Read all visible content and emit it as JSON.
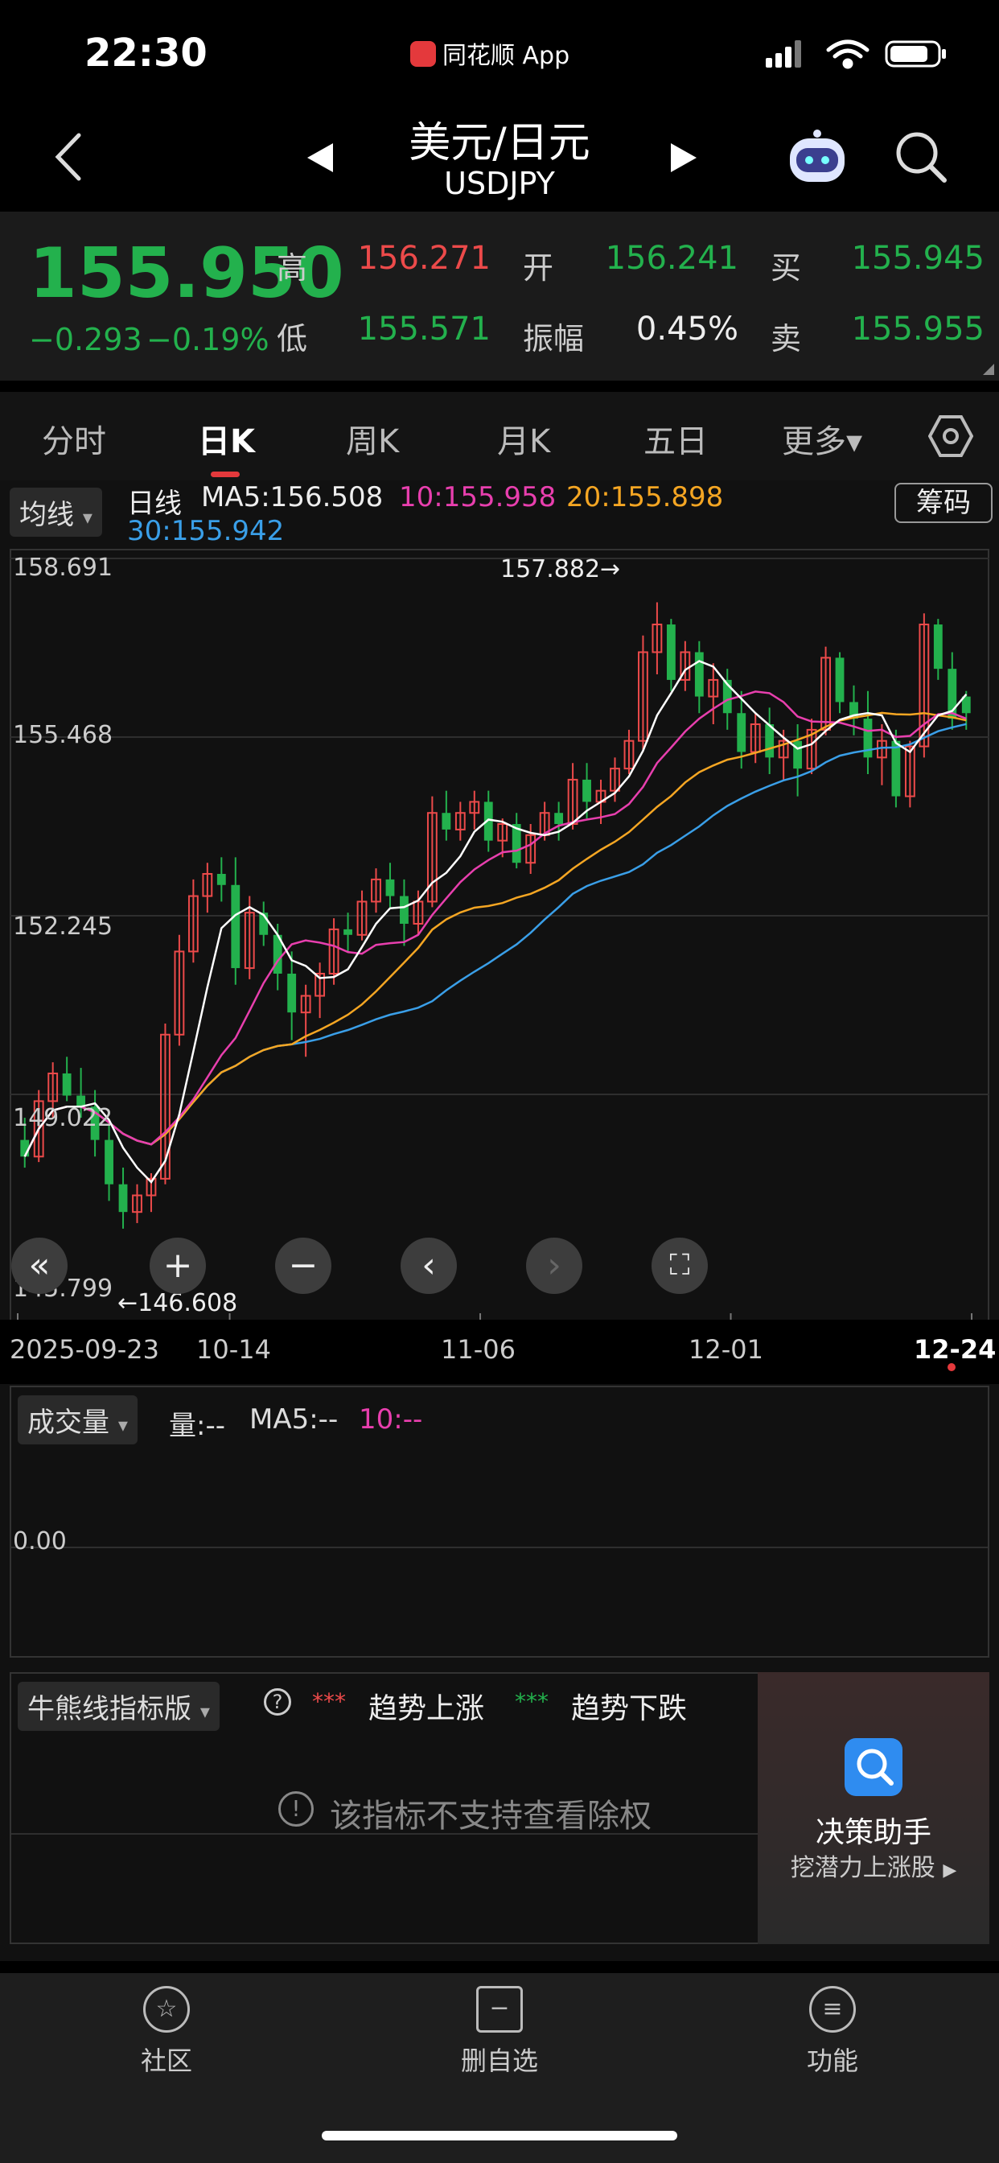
{
  "status_bar": {
    "time": "22:30",
    "app_name": "同花顺 App"
  },
  "nav": {
    "title": "美元/日元",
    "symbol": "USDJPY"
  },
  "quote": {
    "price": "155.950",
    "change": "−0.293",
    "change_pct": "−0.19%",
    "high_label": "高",
    "high": "156.271",
    "low_label": "低",
    "low": "155.571",
    "open_label": "开",
    "open": "156.241",
    "amp_label": "振幅",
    "amp": "0.45%",
    "bid_label": "买",
    "bid": "155.945",
    "ask_label": "卖",
    "ask": "155.955"
  },
  "tabs": [
    "分时",
    "日K",
    "周K",
    "月K",
    "五日",
    "更多▾"
  ],
  "ma_bar": {
    "selector": "均线",
    "period": "日线",
    "ma5": "MA5:156.508",
    "ma10": "10:155.958",
    "ma20": "20:155.898",
    "ma30": "30:155.942",
    "chip_button": "筹码"
  },
  "chart_annotations": {
    "high_marker": "157.882→",
    "low_marker": "←146.608"
  },
  "chart_data": {
    "type": "candlestick",
    "y_axis_ticks": [
      "158.691",
      "155.468",
      "152.245",
      "149.022",
      "145.799"
    ],
    "ylim": [
      145.799,
      158.691
    ],
    "x_axis_ticks": [
      "2025-09-23",
      "10-14",
      "11-06",
      "12-01",
      "12-24"
    ],
    "series_colors": {
      "ma5": "#ffffff",
      "ma10": "#e83fae",
      "ma20": "#f5a623",
      "ma30": "#3a9fe8",
      "up": "#ec4a4a",
      "down": "#23b14d"
    },
    "candles": [
      [
        148.2,
        148.6,
        147.7,
        147.9
      ],
      [
        147.9,
        149.1,
        147.8,
        148.9
      ],
      [
        148.9,
        149.6,
        148.6,
        149.4
      ],
      [
        149.4,
        149.7,
        148.9,
        149.0
      ],
      [
        149.0,
        149.5,
        148.6,
        148.8
      ],
      [
        148.8,
        149.1,
        147.9,
        148.2
      ],
      [
        148.2,
        148.5,
        147.1,
        147.4
      ],
      [
        147.4,
        147.7,
        146.6,
        146.9
      ],
      [
        146.9,
        147.4,
        146.7,
        147.2
      ],
      [
        147.2,
        147.6,
        146.9,
        147.5
      ],
      [
        147.5,
        150.3,
        147.4,
        150.1
      ],
      [
        150.1,
        151.9,
        149.9,
        151.6
      ],
      [
        151.6,
        152.9,
        151.4,
        152.6
      ],
      [
        152.6,
        153.2,
        152.3,
        153.0
      ],
      [
        153.0,
        153.3,
        152.5,
        152.8
      ],
      [
        152.8,
        153.3,
        151.0,
        151.3
      ],
      [
        151.3,
        152.6,
        151.1,
        152.3
      ],
      [
        152.3,
        152.5,
        151.7,
        151.9
      ],
      [
        151.9,
        152.1,
        150.9,
        151.2
      ],
      [
        151.2,
        151.6,
        150.0,
        150.5
      ],
      [
        150.5,
        151.0,
        149.7,
        150.8
      ],
      [
        150.8,
        151.4,
        150.4,
        151.2
      ],
      [
        151.2,
        152.2,
        151.0,
        152.0
      ],
      [
        152.0,
        152.3,
        151.6,
        151.9
      ],
      [
        151.9,
        152.7,
        151.8,
        152.5
      ],
      [
        152.5,
        153.1,
        152.3,
        152.9
      ],
      [
        152.9,
        153.2,
        152.4,
        152.6
      ],
      [
        152.6,
        152.9,
        151.7,
        152.1
      ],
      [
        152.1,
        152.7,
        151.9,
        152.5
      ],
      [
        152.5,
        154.4,
        152.4,
        154.1
      ],
      [
        154.1,
        154.5,
        153.6,
        153.8
      ],
      [
        153.8,
        154.3,
        153.6,
        154.1
      ],
      [
        154.1,
        154.5,
        153.8,
        154.3
      ],
      [
        154.3,
        154.5,
        153.4,
        153.6
      ],
      [
        153.6,
        154.0,
        153.3,
        153.9
      ],
      [
        153.9,
        154.1,
        153.1,
        153.2
      ],
      [
        153.2,
        153.9,
        153.0,
        153.7
      ],
      [
        153.7,
        154.3,
        153.6,
        154.1
      ],
      [
        154.1,
        154.3,
        153.6,
        153.9
      ],
      [
        153.9,
        155.0,
        153.8,
        154.7
      ],
      [
        154.7,
        155.0,
        154.0,
        154.3
      ],
      [
        154.3,
        154.7,
        153.9,
        154.5
      ],
      [
        154.5,
        155.1,
        154.3,
        154.9
      ],
      [
        154.9,
        155.6,
        154.8,
        155.4
      ],
      [
        155.4,
        157.3,
        155.2,
        157.0
      ],
      [
        157.0,
        157.9,
        156.6,
        157.5
      ],
      [
        157.5,
        157.6,
        156.3,
        156.5
      ],
      [
        156.5,
        157.2,
        156.3,
        157.0
      ],
      [
        157.0,
        157.2,
        155.9,
        156.2
      ],
      [
        156.2,
        156.8,
        155.7,
        156.5
      ],
      [
        156.5,
        156.7,
        155.6,
        155.9
      ],
      [
        155.9,
        156.3,
        154.9,
        155.2
      ],
      [
        155.2,
        155.9,
        155.0,
        155.7
      ],
      [
        155.7,
        156.0,
        154.8,
        155.1
      ],
      [
        155.1,
        155.6,
        154.7,
        155.4
      ],
      [
        155.4,
        155.7,
        154.4,
        154.9
      ],
      [
        154.9,
        155.8,
        154.8,
        155.6
      ],
      [
        155.6,
        157.1,
        155.5,
        156.9
      ],
      [
        156.9,
        157.0,
        155.9,
        156.1
      ],
      [
        156.1,
        156.4,
        155.5,
        155.8
      ],
      [
        155.8,
        156.3,
        154.8,
        155.1
      ],
      [
        155.1,
        155.7,
        154.6,
        155.4
      ],
      [
        155.4,
        155.6,
        154.2,
        154.4
      ],
      [
        154.4,
        155.4,
        154.2,
        155.3
      ],
      [
        155.3,
        157.7,
        155.1,
        157.5
      ],
      [
        157.5,
        157.6,
        156.5,
        156.7
      ],
      [
        156.7,
        157.0,
        155.6,
        155.8
      ],
      [
        156.2,
        156.3,
        155.6,
        155.9
      ]
    ]
  },
  "volume_panel": {
    "selector": "成交量",
    "vol": "量:--",
    "ma5": "MA5:--",
    "ma10": "10:--",
    "zero_label": "0.00"
  },
  "indicator_panel": {
    "selector": "牛熊线指标版",
    "help": "?",
    "trend_up_dots": "***",
    "trend_up": "趋势上涨",
    "trend_down_dots": "***",
    "trend_down": "趋势下跌",
    "notice": "该指标不支持查看除权"
  },
  "decision_card": {
    "title": "决策助手",
    "subtitle": "挖潜力上涨股"
  },
  "bottom_nav": [
    {
      "label": "社区",
      "icon": "community-icon"
    },
    {
      "label": "删自选",
      "icon": "remove-watchlist-icon"
    },
    {
      "label": "功能",
      "icon": "menu-icon"
    }
  ]
}
